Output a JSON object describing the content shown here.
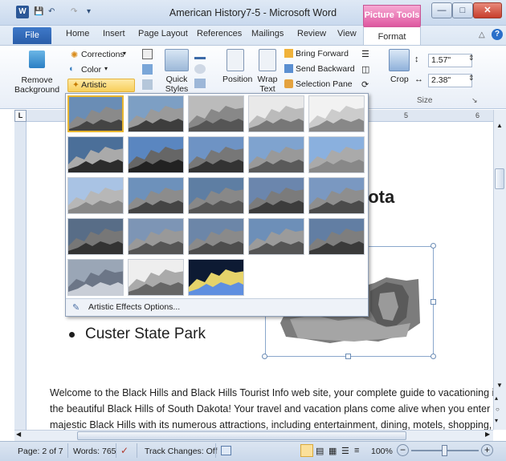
{
  "window": {
    "title": "American History7-5 - Microsoft Word",
    "context_tab": "Picture Tools"
  },
  "tabs": [
    "File",
    "Home",
    "Insert",
    "Page Layout",
    "References",
    "Mailings",
    "Review",
    "View",
    "Format"
  ],
  "ribbon": {
    "remove_background": "Remove Background",
    "corrections": "Corrections",
    "color": "Color",
    "artistic_effects": "Artistic Effects",
    "quick_styles": "Quick Styles",
    "position": "Position",
    "wrap_text": "Wrap Text",
    "bring_forward": "Bring Forward",
    "send_backward": "Send Backward",
    "selection_pane": "Selection Pane",
    "crop": "Crop",
    "height": "1.57\"",
    "width": "2.38\"",
    "size_group": "Size"
  },
  "ruler": {
    "marks": [
      "5",
      "6"
    ]
  },
  "gallery": {
    "options_label": "Artistic Effects Options...",
    "items": [
      "None",
      "Marker",
      "Pencil Grayscale",
      "Pencil Sketch",
      "Line Drawing",
      "Chalk Sketch",
      "Paint Strokes",
      "Paint Brush",
      "Glow Diffused",
      "Blur",
      "Light Screen",
      "Watercolor Sponge",
      "Film Grain",
      "Mosaic Bubbles",
      "Glass",
      "Cement",
      "Texturizer",
      "Crisscross Etching",
      "Pastels Smooth",
      "Plastic Wrap",
      "Cutout",
      "Photocopy",
      "Glow Edges"
    ]
  },
  "document": {
    "heading_fragment": "kota",
    "bullet": "Custer State Park",
    "paragraph_lines": [
      "Welcome to the Black Hills and Black Hills Tourist Info web site, your complete guide to vacationing i",
      "the beautiful Black Hills of South Dakota! Your travel and vacation plans come alive when you enter t",
      "majestic Black Hills with its numerous attractions, including entertainment, dining, motels, shopping,"
    ]
  },
  "status": {
    "page": "Page: 2 of 7",
    "words": "Words: 765",
    "track_changes": "Track Changes: Off",
    "zoom": "100%"
  },
  "colors": {
    "accent": "#e8b630",
    "context": "#e05aa2",
    "file_tab": "#2a5da9"
  }
}
